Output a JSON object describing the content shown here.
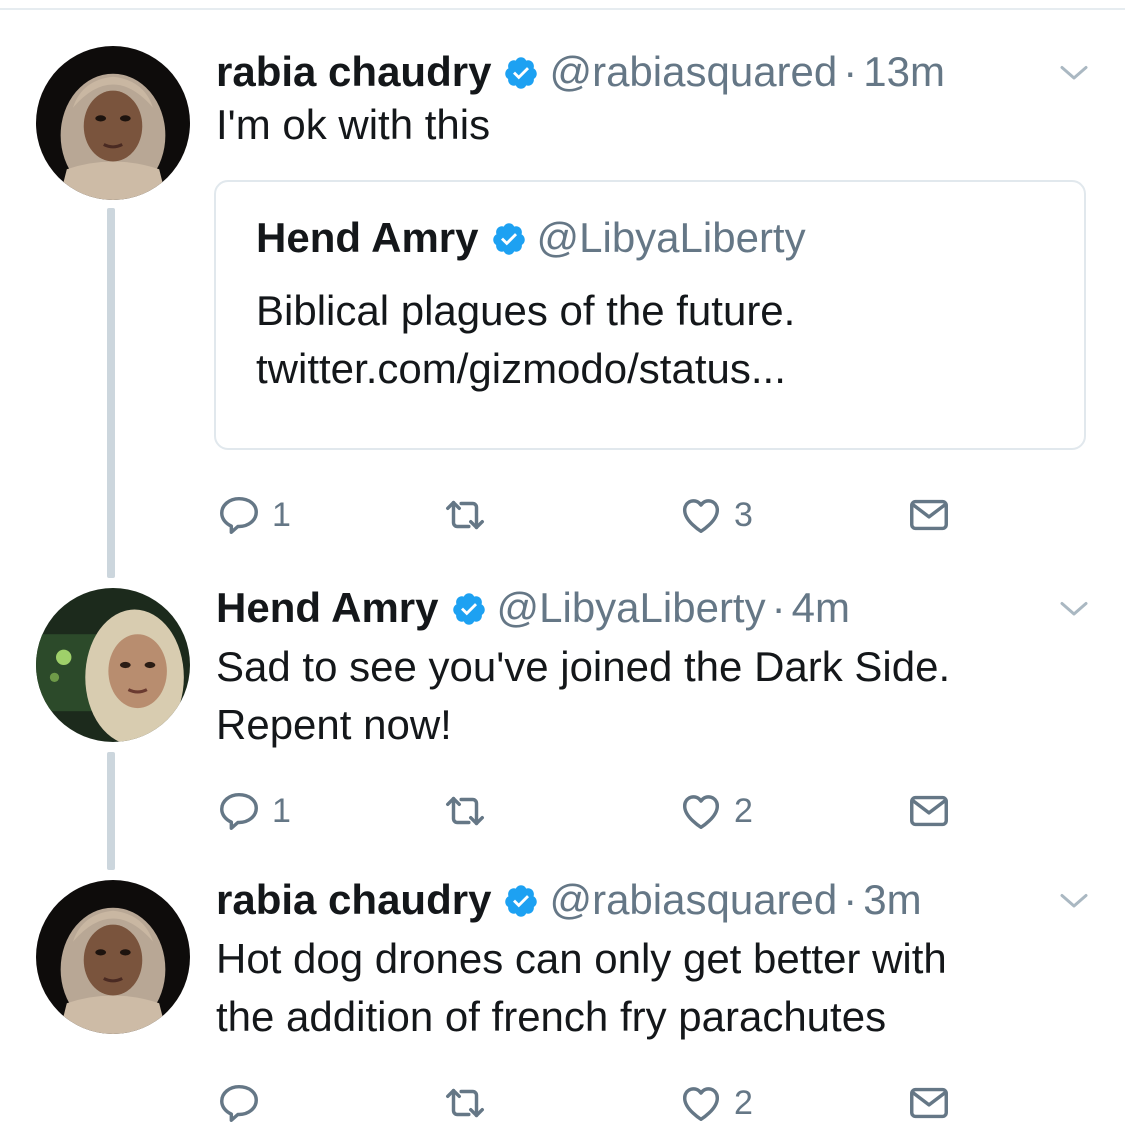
{
  "tweets": [
    {
      "name": "rabia chaudry",
      "handle": "@rabiasquared",
      "separator": "·",
      "time": "13m",
      "text": "I'm ok with this",
      "quote": {
        "name": "Hend Amry",
        "handle": "@LibyaLiberty",
        "text_line1": "Biblical plagues of the future.",
        "text_line2": "twitter.com/gizmodo/status..."
      },
      "reply_count": "1",
      "retweet_count": "",
      "like_count": "3"
    },
    {
      "name": "Hend Amry",
      "handle": "@LibyaLiberty",
      "separator": "·",
      "time": "4m",
      "text_line1": "Sad to see you've joined the Dark Side.",
      "text_line2": "Repent now!",
      "reply_count": "1",
      "retweet_count": "",
      "like_count": "2"
    },
    {
      "name": "rabia chaudry",
      "handle": "@rabiasquared",
      "separator": "·",
      "time": "3m",
      "text_line1": "Hot dog drones can only get better with",
      "text_line2": "the addition of french fry parachutes",
      "reply_count": "",
      "retweet_count": "",
      "like_count": "2"
    }
  ],
  "icons": {
    "verified": "verified-badge-icon",
    "menu": "chevron-down-icon",
    "reply": "reply-icon",
    "retweet": "retweet-icon",
    "like": "heart-icon",
    "dm": "envelope-icon"
  },
  "colors": {
    "verified_blue": "#1da1f2",
    "secondary_text": "#657786",
    "thread_line": "#ccd6dd",
    "border": "#e1e8ed"
  }
}
